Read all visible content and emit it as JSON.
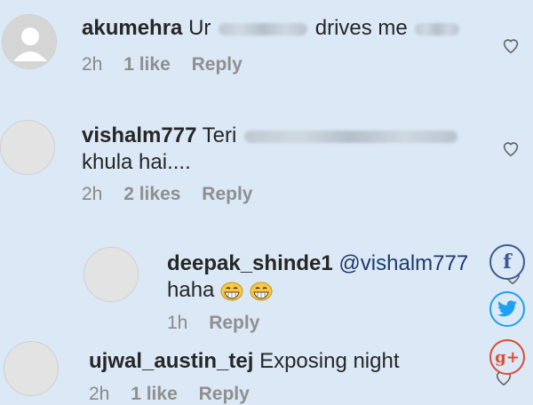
{
  "comments": [
    {
      "username": "akumehra",
      "text_before": "Ur",
      "text_middle": "drives me",
      "time": "2h",
      "likes": "1 like",
      "reply": "Reply"
    },
    {
      "username": "vishalm777",
      "text_before": "Teri",
      "text_line2": "khula hai....",
      "time": "2h",
      "likes": "2 likes",
      "reply": "Reply"
    },
    {
      "username": "deepak_shinde1",
      "mention": "@vishalm777",
      "text_line2": "haha",
      "time": "1h",
      "reply": "Reply"
    },
    {
      "username": "ujwal_austin_tej",
      "text_before": "Exposing night",
      "time": "2h",
      "likes": "1 like",
      "reply": "Reply"
    }
  ],
  "share_buttons": [
    {
      "icon": "facebook-icon",
      "glyph": "f",
      "color": "#3b5998"
    },
    {
      "icon": "twitter-icon",
      "color": "#1da1f2"
    },
    {
      "icon": "google-plus-icon",
      "glyph": "g+",
      "color": "#dd4b39"
    }
  ]
}
